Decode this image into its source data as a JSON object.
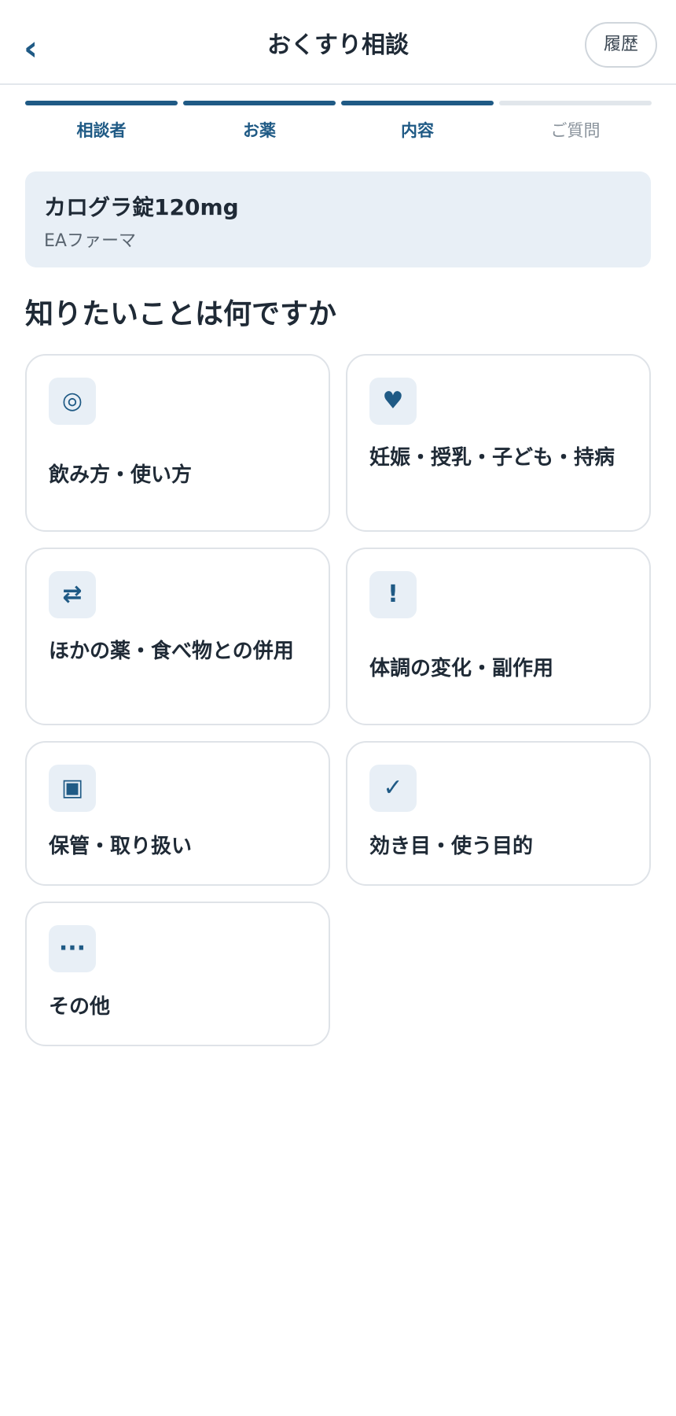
{
  "header": {
    "back_icon": "‹",
    "title": "おくすり相談",
    "history_label": "履歴"
  },
  "steps": [
    {
      "label": "相談者",
      "state": "done"
    },
    {
      "label": "お薬",
      "state": "done"
    },
    {
      "label": "内容",
      "state": "current"
    },
    {
      "label": "ご質問",
      "state": "todo"
    }
  ],
  "drug": {
    "name": "カログラ錠120mg",
    "maker": "EAファーマ"
  },
  "question": "知りたいことは何ですか",
  "options": [
    {
      "icon": "◎",
      "icon_name": "target-icon",
      "label": "飲み方・使い方"
    },
    {
      "icon": "♥",
      "icon_name": "heart-icon",
      "label": "妊娠・授乳・子ども・持病"
    },
    {
      "icon": "⇄",
      "icon_name": "swap-icon",
      "label": "ほかの薬・食べ物との併用"
    },
    {
      "icon": "!",
      "icon_name": "exclamation-icon",
      "label": "体調の変化・副作用"
    },
    {
      "icon": "▣",
      "icon_name": "box-icon",
      "label": "保管・取り扱い"
    },
    {
      "icon": "✓",
      "icon_name": "check-icon",
      "label": "効き目・使う目的"
    },
    {
      "icon": "···",
      "icon_name": "more-icon",
      "label": "その他"
    }
  ],
  "colors": {
    "accent": "#1f5a85",
    "card_bg": "#e8eff6",
    "inactive_step": "#e1e6eb"
  }
}
